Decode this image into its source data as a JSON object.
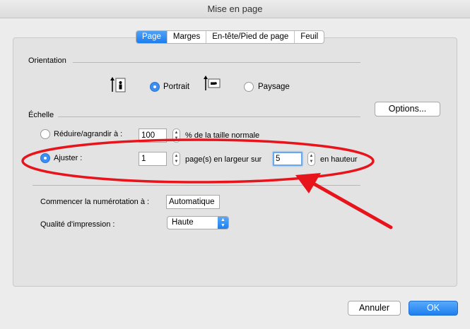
{
  "window": {
    "title": "Mise en page"
  },
  "tabs": [
    {
      "label": "Page",
      "active": true
    },
    {
      "label": "Marges",
      "active": false
    },
    {
      "label": "En-tête/Pied de page",
      "active": false
    },
    {
      "label": "Feuil",
      "active": false
    }
  ],
  "orientation": {
    "heading": "Orientation",
    "portrait_label": "Portrait",
    "landscape_label": "Paysage",
    "selected": "Portrait"
  },
  "options_button": "Options...",
  "scale": {
    "heading": "Échelle",
    "reduce_label": "Réduire/agrandir à :",
    "reduce_value": "100",
    "reduce_suffix": "% de la taille normale",
    "fit_label": "Ajuster :",
    "fit_width_value": "1",
    "fit_middle": "page(s) en largeur sur",
    "fit_height_value": "5",
    "fit_suffix": "en hauteur",
    "selected": "Ajuster"
  },
  "numbering": {
    "label": "Commencer la numérotation à :",
    "value": "Automatique"
  },
  "quality": {
    "label": "Qualité d'impression :",
    "value": "Haute"
  },
  "buttons": {
    "cancel": "Annuler",
    "ok": "OK"
  },
  "annotation": {
    "color": "#e8141c"
  }
}
